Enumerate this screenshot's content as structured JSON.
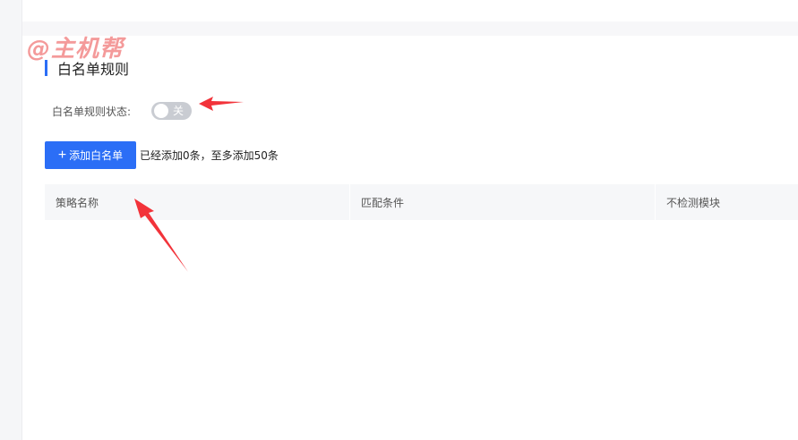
{
  "watermark": {
    "text": "@主机帮"
  },
  "section": {
    "title": "白名单规则"
  },
  "status": {
    "label": "白名单规则状态:",
    "toggle_text": "关"
  },
  "actions": {
    "add_label": "添加白名单",
    "add_hint": "已经添加0条，至多添加50条"
  },
  "table": {
    "columns": [
      "策略名称",
      "匹配条件",
      "不检测模块"
    ]
  },
  "colors": {
    "accent": "#2b6ef6",
    "annotation": "#f2333a",
    "toggle_off": "#c9ccd2"
  }
}
